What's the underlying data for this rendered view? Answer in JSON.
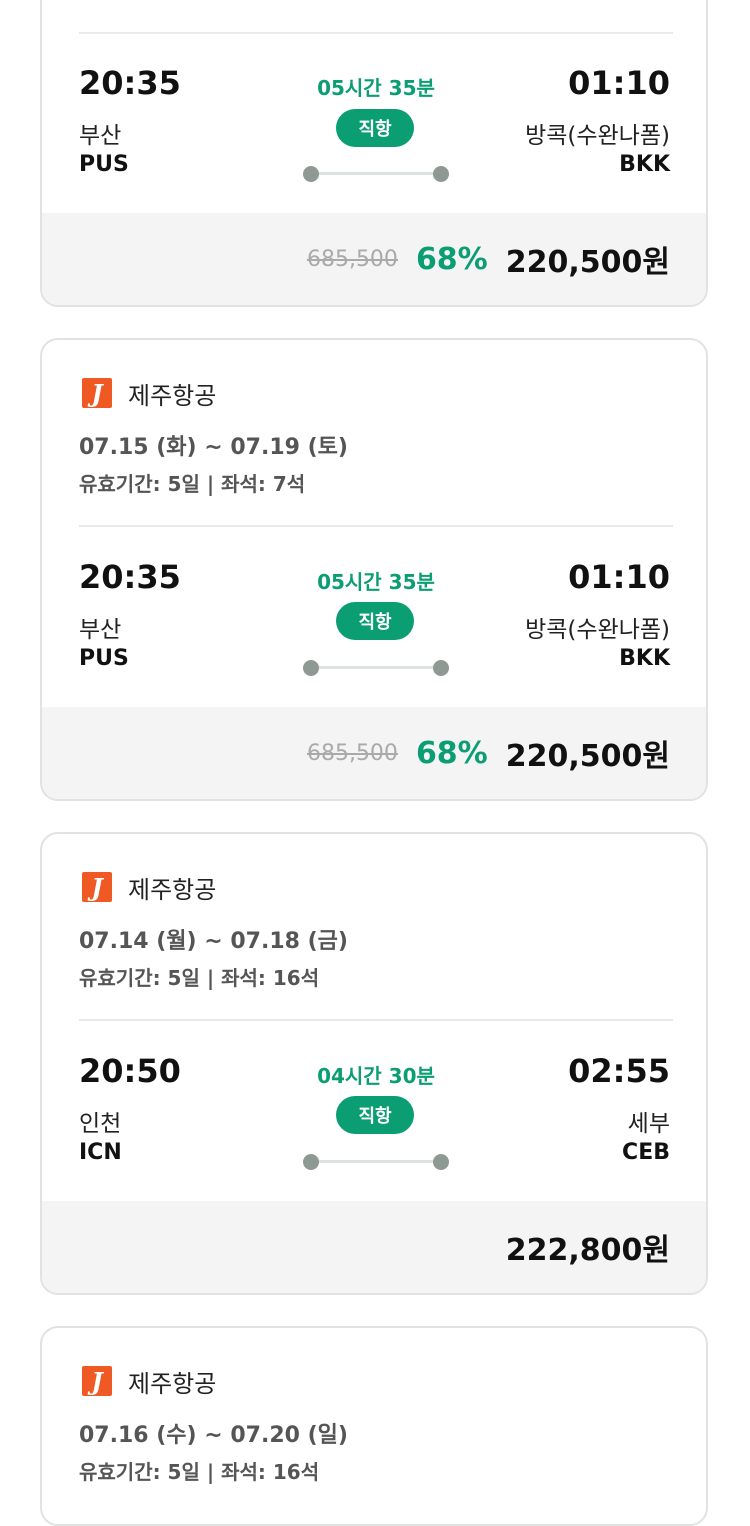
{
  "currency_suffix": "원",
  "cards": [
    {
      "airline": "",
      "dates": "",
      "meta": "",
      "dep_time": "20:35",
      "dep_city": "부산",
      "dep_code": "PUS",
      "duration": "05시간 35분",
      "direct_label": "직항",
      "arr_time": "01:10",
      "arr_city": "방콕(수완나폼)",
      "arr_code": "BKK",
      "original_price": "685,500",
      "discount": "68%",
      "price": "220,500원"
    },
    {
      "airline": "제주항공",
      "dates": "07.15 (화) ~ 07.19 (토)",
      "meta": "유효기간: 5일 | 좌석: 7석",
      "dep_time": "20:35",
      "dep_city": "부산",
      "dep_code": "PUS",
      "duration": "05시간 35분",
      "direct_label": "직항",
      "arr_time": "01:10",
      "arr_city": "방콕(수완나폼)",
      "arr_code": "BKK",
      "original_price": "685,500",
      "discount": "68%",
      "price": "220,500원"
    },
    {
      "airline": "제주항공",
      "dates": "07.14 (월) ~ 07.18 (금)",
      "meta": "유효기간: 5일 | 좌석: 16석",
      "dep_time": "20:50",
      "dep_city": "인천",
      "dep_code": "ICN",
      "duration": "04시간 30분",
      "direct_label": "직항",
      "arr_time": "02:55",
      "arr_city": "세부",
      "arr_code": "CEB",
      "original_price": "",
      "discount": "",
      "price": "222,800원"
    },
    {
      "airline": "제주항공",
      "dates": "07.16 (수) ~ 07.20 (일)",
      "meta": "유효기간: 5일 | 좌석: 16석"
    }
  ],
  "logo_letter": "J"
}
